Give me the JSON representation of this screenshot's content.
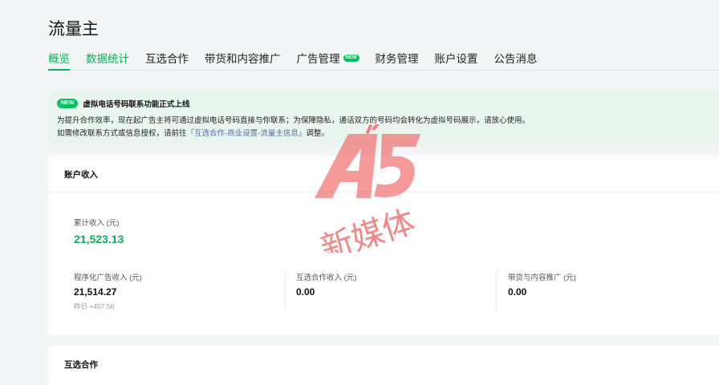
{
  "app": {
    "title": "流量主"
  },
  "tabs": [
    {
      "label": "概览",
      "active": true
    },
    {
      "label": "数据统计",
      "active": false
    },
    {
      "label": "互选合作",
      "active": false
    },
    {
      "label": "带货和内容推广",
      "active": false
    },
    {
      "label": "广告管理",
      "active": false,
      "badge": "NEW"
    },
    {
      "label": "财务管理",
      "active": false
    },
    {
      "label": "账户设置",
      "active": false
    },
    {
      "label": "公告消息",
      "active": false
    }
  ],
  "notice": {
    "badge": "NEW",
    "title": "虚拟电话号码联系功能正式上线",
    "line1": "为提升合作效率，现在起广告主将可通过虚拟电话号码直接与你联系；为保障隐私，通话双方的号码均会转化为虚拟号码展示，请放心使用。",
    "line2_prefix": "如需修改联系方式或信息授权，请前往",
    "line2_link": "「互选合作-商业设置-流量主信息」",
    "line2_suffix": "调整。"
  },
  "income": {
    "header": "账户收入",
    "total_label": "累计收入 (元)",
    "total_value": "21,523.13",
    "metrics": [
      {
        "label": "程序化广告收入 (元)",
        "value": "21,514.27",
        "sub": "昨日 +457.56"
      },
      {
        "label": "互选合作收入 (元)",
        "value": "0.00"
      },
      {
        "label": "带货与内容推广 (元)",
        "value": "0.00"
      }
    ]
  },
  "section2": {
    "header": "互选合作"
  },
  "watermark": {
    "logo": "A5",
    "text": "新媒体"
  },
  "colors": {
    "accent": "#07b15a",
    "notice_bg": "#e9f6ef",
    "link": "#576b95",
    "watermark": "#f06a6a"
  }
}
